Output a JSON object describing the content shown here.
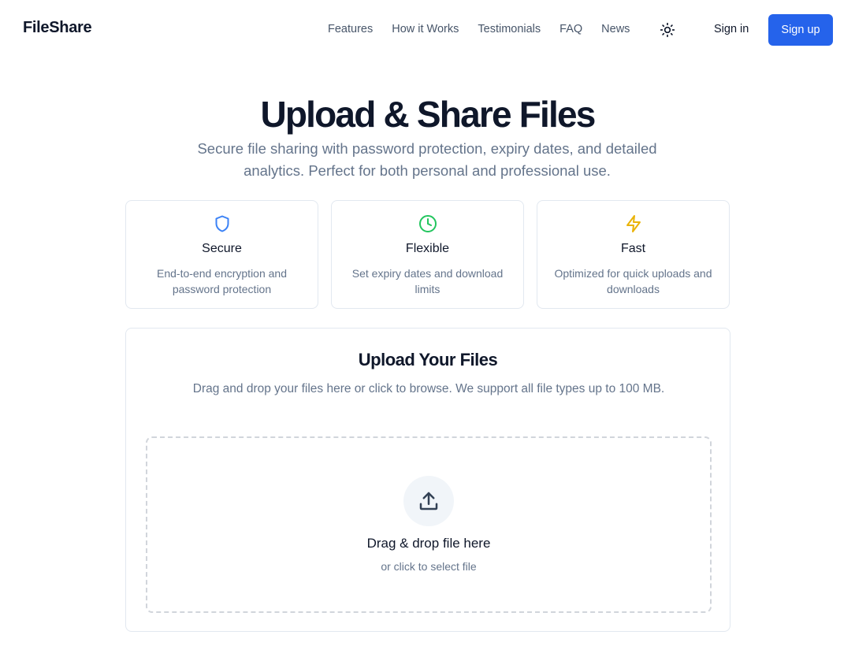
{
  "header": {
    "brand": "FileShare",
    "nav": [
      "Features",
      "How it Works",
      "Testimonials",
      "FAQ",
      "News"
    ],
    "theme_icon": "sun-icon",
    "signin_label": "Sign in",
    "signup_label": "Sign up"
  },
  "hero": {
    "title": "Upload & Share Files",
    "subtitle": "Secure file sharing with password protection, expiry dates, and detailed analytics. Perfect for both personal and professional use."
  },
  "features": [
    {
      "icon": "shield-icon",
      "color": "#3b82f6",
      "title": "Secure",
      "desc": "End-to-end encryption and password protection"
    },
    {
      "icon": "clock-icon",
      "color": "#22c55e",
      "title": "Flexible",
      "desc": "Set expiry dates and download limits"
    },
    {
      "icon": "lightning-icon",
      "color": "#eab308",
      "title": "Fast",
      "desc": "Optimized for quick uploads and downloads"
    }
  ],
  "upload": {
    "title": "Upload Your Files",
    "desc": "Drag and drop your files here or click to browse. We support all file types up to 100 MB.",
    "drop_title": "Drag & drop file here",
    "drop_sub": "or click to select file"
  },
  "colors": {
    "accent": "#2563eb",
    "text": "#0f172a",
    "muted": "#64748b",
    "border": "#e2e8f0"
  }
}
